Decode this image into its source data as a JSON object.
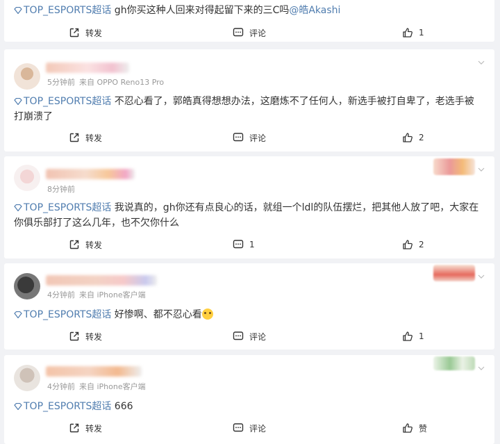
{
  "comments": [
    {
      "tag": "TOP_ESPORTS超话",
      "text": " gh你买这种人回来对得起留下来的三C吗",
      "mention": "@皓Akashi",
      "repost": "转发",
      "comment": "评论",
      "like": "1"
    },
    {
      "time": "5分钟前",
      "source": "来自 OPPO Reno13 Pro",
      "tag": "TOP_ESPORTS超话",
      "text": " 不忍心看了，郭皓真得想想办法，这磨炼不了任何人，新选手被打自卑了，老选手被打崩溃了",
      "repost": "转发",
      "comment": "评论",
      "like": "2"
    },
    {
      "time": "8分钟前",
      "tag": "TOP_ESPORTS超话",
      "text": " 我说真的，gh你还有点良心的话，就组一个ldl的队伍摆烂，把其他人放了吧，大家在你俱乐部打了这么几年，也不欠你什么",
      "repost": "转发",
      "comment": "1",
      "like": "2"
    },
    {
      "time": "4分钟前",
      "source": "来自 iPhone客户端",
      "tag": "TOP_ESPORTS超话",
      "text": " 好惨啊、都不忍心看",
      "repost": "转发",
      "comment": "评论",
      "like": "1"
    },
    {
      "time": "4分钟前",
      "source": "来自 iPhone客户端",
      "tag": "TOP_ESPORTS超话",
      "text": " 666",
      "repost": "转发",
      "comment": "评论",
      "like": "赞"
    }
  ],
  "icons": {
    "tag": "diamond-icon",
    "repost": "repost-icon",
    "comment": "comment-icon",
    "like": "thumbs-up-icon",
    "expand": "chevron-down-icon"
  },
  "colors": {
    "link": "#507daf",
    "meta": "#999999",
    "background": "#f1f2f5"
  }
}
